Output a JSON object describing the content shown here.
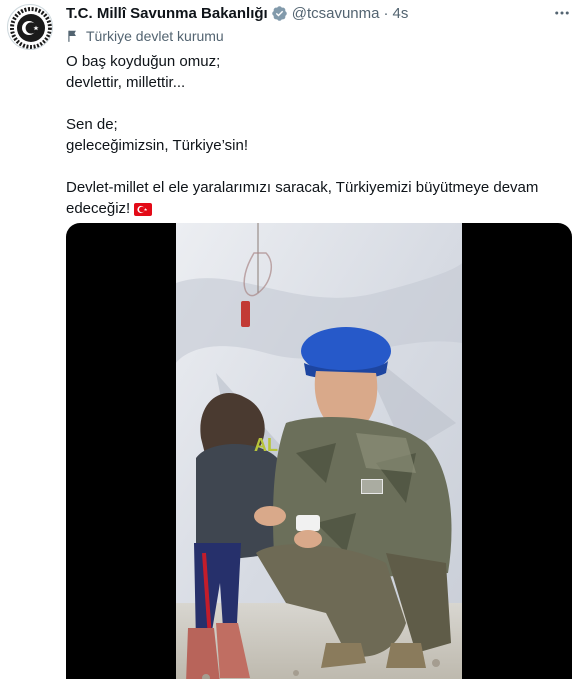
{
  "author": {
    "name": "T.C. Millî Savunma Bakanlığı",
    "handle": "@tcsavunma",
    "separator": "·",
    "time": "4s",
    "affiliation": "Türkiye devlet kurumu",
    "verified_color": "#829aab"
  },
  "body": {
    "line1": "O baş koyduğun omuz;",
    "line2": "devlettir, millettir...",
    "line3": "Sen de;",
    "line4": "geleceğimizsin, Türkiye’sin!",
    "line5": "Devlet-millet el ele yaralarımızı saracak, Türkiyemizi büyütmeye devam",
    "line6": "edeceğiz!"
  },
  "icons": {
    "more": "more-horizontal-icon",
    "affiliation": "flag-outline-icon",
    "verified": "verified-badge-icon",
    "emoji": "turkey-flag-emoji"
  },
  "colors": {
    "text": "#0f1419",
    "secondary": "#536471",
    "media_background": "#000000",
    "flag_red": "#e30a17"
  }
}
